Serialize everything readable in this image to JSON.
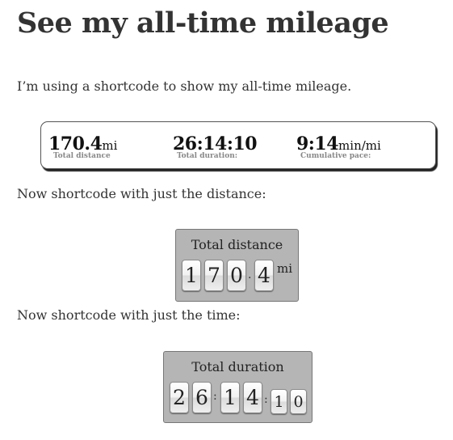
{
  "page": {
    "title": "See my all-time mileage",
    "intro": "I’m using a shortcode to show my all-time mileage.",
    "distance_heading": "Now shortcode with just the distance:",
    "time_heading": "Now shortcode with just the time:"
  },
  "summary": {
    "distance_value": "170.4",
    "distance_unit": "mi",
    "distance_label": "Total distance",
    "duration_value": "26:14:10",
    "duration_label": "Total duration:",
    "pace_value": "9:14",
    "pace_unit": "min/mi",
    "pace_label": "Cumulative pace:"
  },
  "distance_widget": {
    "title": "Total distance",
    "digits": [
      "1",
      "7",
      "0",
      "4"
    ],
    "decimal_separator": ".",
    "unit": "mi"
  },
  "duration_widget": {
    "title": "Total duration",
    "digits": [
      "2",
      "6",
      "1",
      "4",
      "1",
      "0"
    ],
    "separator": ":"
  },
  "colors": {
    "text": "#333333",
    "widget_background": "#b5b5b5",
    "summary_label": "#888888"
  }
}
